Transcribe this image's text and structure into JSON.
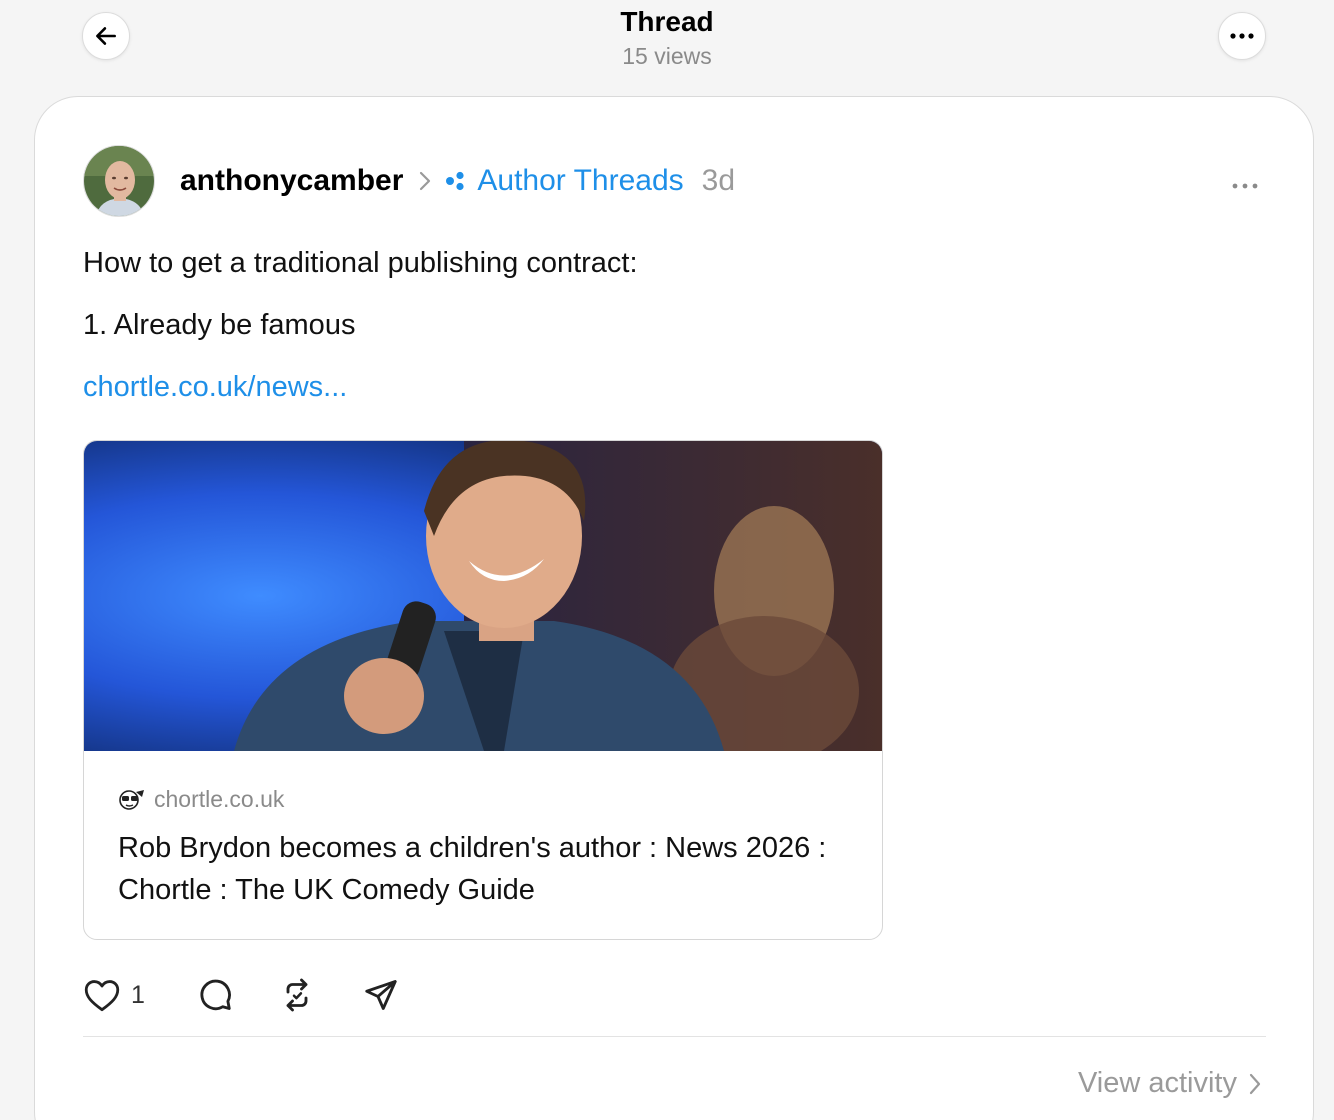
{
  "topbar": {
    "title": "Thread",
    "views": "15 views",
    "back_icon": "arrow-left-icon",
    "more_icon": "ellipsis-icon"
  },
  "post": {
    "username": "anthonycamber",
    "topic": "Author Threads",
    "time": "3d",
    "text_line1": "How to get a traditional publishing contract:",
    "text_line2": "1. Already be famous",
    "link_text": "chortle.co.uk/news...",
    "link_preview": {
      "site": "chortle.co.uk",
      "title": "Rob Brydon becomes a children's author : News 2026 : Chortle : The UK Comedy Guide"
    },
    "actions": {
      "like_count": "1",
      "icons": [
        "heart-icon",
        "comment-icon",
        "repost-icon",
        "share-icon"
      ]
    },
    "view_activity": "View activity"
  },
  "colors": {
    "accent": "#1e8fe8",
    "muted": "#9a9a9a",
    "background": "#f5f5f5"
  }
}
